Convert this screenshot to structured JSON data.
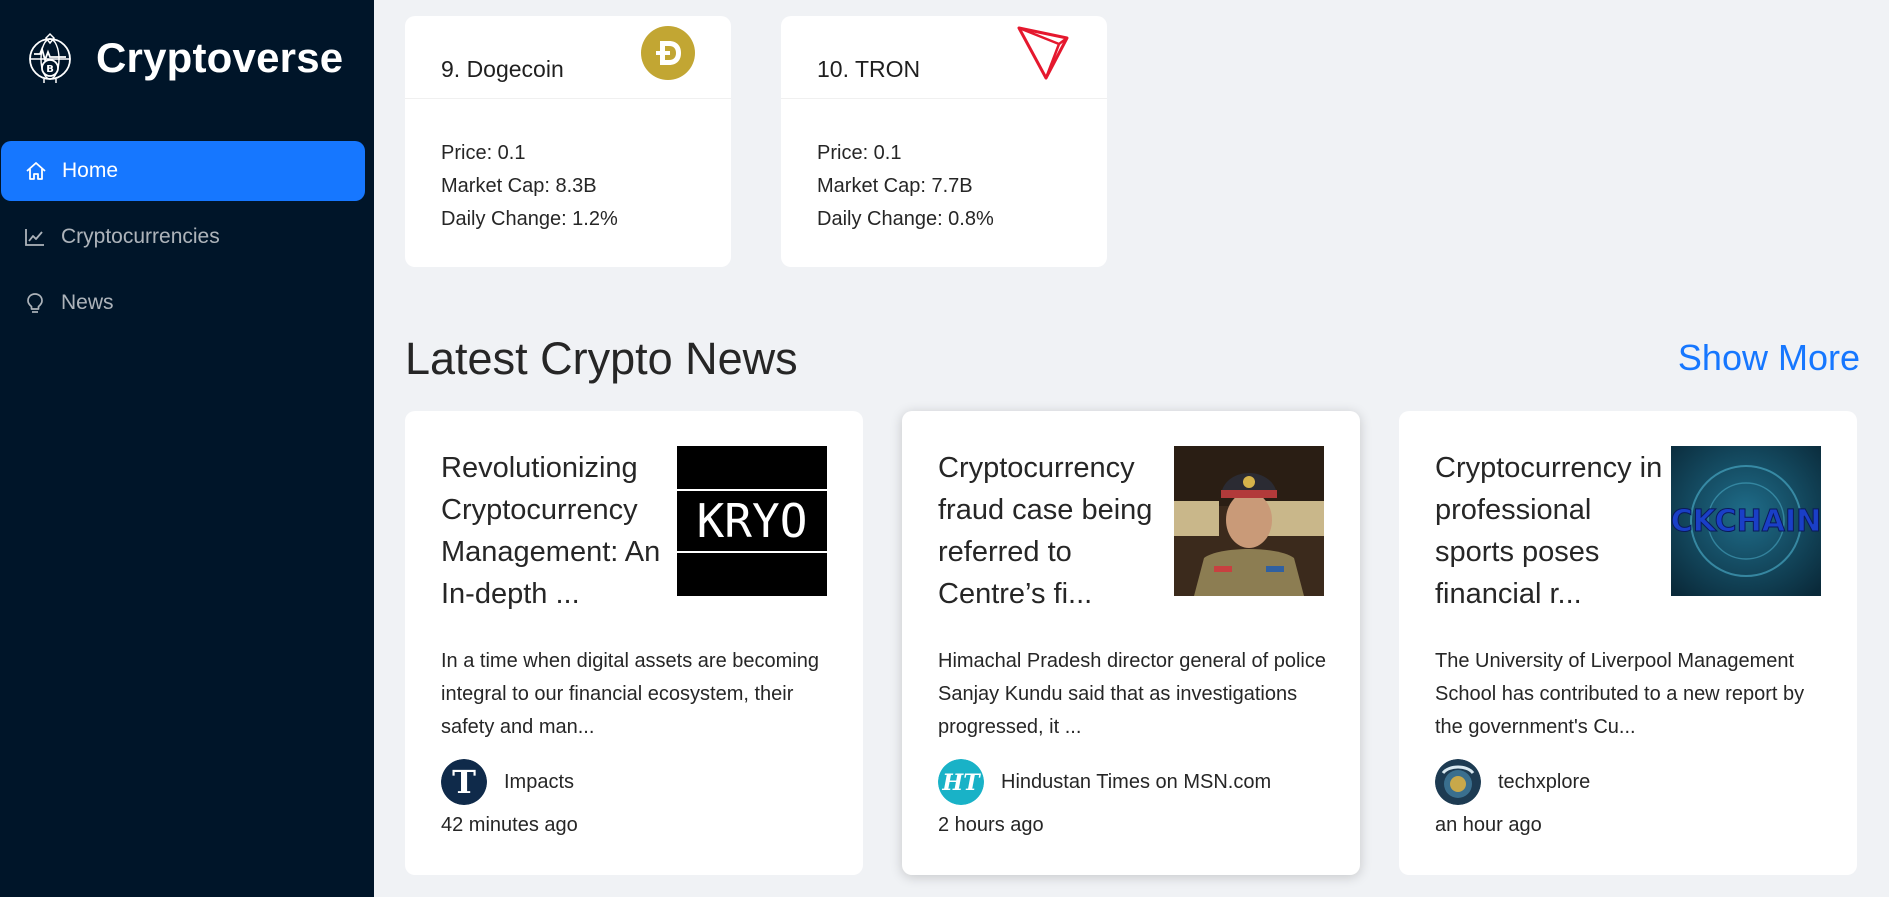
{
  "brand": {
    "title": "Cryptoverse",
    "logo_icon": "crypto-globe-logo"
  },
  "sidebar": {
    "items": [
      {
        "label": "Home",
        "icon": "home-icon",
        "active": true
      },
      {
        "label": "Cryptocurrencies",
        "icon": "line-chart-icon",
        "active": false
      },
      {
        "label": "News",
        "icon": "bulb-icon",
        "active": false
      }
    ]
  },
  "coins": [
    {
      "name": "9. Dogecoin",
      "icon": "dogecoin-icon",
      "price": "Price: 0.1",
      "market_cap": "Market Cap: 8.3B",
      "daily_change": "Daily Change: 1.2%",
      "color": "#C2A633"
    },
    {
      "name": "10. TRON",
      "icon": "tron-icon",
      "price": "Price: 0.1",
      "market_cap": "Market Cap: 7.7B",
      "daily_change": "Daily Change: 0.8%",
      "color": "#E5182E"
    }
  ],
  "news_section": {
    "heading": "Latest Crypto News",
    "show_more": "Show More",
    "accent": "#1677ff"
  },
  "news": [
    {
      "title": "Revolutionizing Cryptocurrency Management: An In-depth ...",
      "thumb_text": "KRYO",
      "description": "In a time when digital assets are becoming integral to our financial ecosystem, their safety and man...",
      "provider": "Impacts",
      "avatar_letter": "T",
      "time": "42 minutes ago"
    },
    {
      "title": "Cryptocurrency fraud case being referred to Centre’s fi...",
      "thumb_text": "",
      "description": "Himachal Pradesh director general of police Sanjay Kundu said that as investigations progressed, it ...",
      "provider": "Hindustan Times on MSN.com",
      "avatar_letter": "HT",
      "time": "2 hours ago"
    },
    {
      "title": "Cryptocurrency in professional sports poses financial r...",
      "thumb_text": "CKCHAIN",
      "description": "The University of Liverpool Management School has contributed to a new report by the government's Cu...",
      "provider": "techxplore",
      "avatar_letter": "",
      "time": "an hour ago"
    }
  ]
}
